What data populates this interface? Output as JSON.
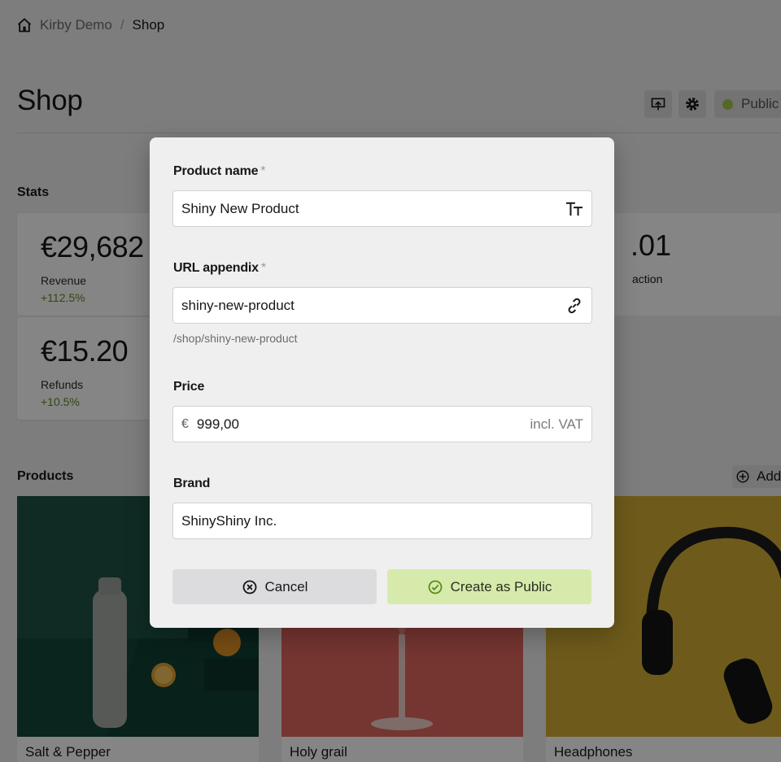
{
  "breadcrumb": {
    "site": "Kirby Demo",
    "separator": "/",
    "current": "Shop"
  },
  "page": {
    "title": "Shop",
    "status_label": "Public"
  },
  "stats": {
    "heading": "Stats",
    "items": [
      {
        "value": "€29,682",
        "label": "Revenue",
        "delta": "+112.5%"
      },
      {
        "value": "€15.20",
        "label": "Refunds",
        "delta": "+10.5%"
      }
    ],
    "partial": {
      "value": ".01",
      "label": "action"
    }
  },
  "products": {
    "heading": "Products",
    "add_label": "Add",
    "items": [
      {
        "name": "Salt & Pepper"
      },
      {
        "name": "Holy grail"
      },
      {
        "name": "Headphones"
      }
    ]
  },
  "dialog": {
    "product_name": {
      "label": "Product name",
      "required": "*",
      "value": "Shiny New Product",
      "icon": "text-icon"
    },
    "url_appendix": {
      "label": "URL appendix",
      "required": "*",
      "value": "shiny-new-product",
      "help": "/shop/shiny-new-product",
      "icon": "link-icon"
    },
    "price": {
      "label": "Price",
      "currency": "€",
      "value": "999,00",
      "after": "incl. VAT"
    },
    "brand": {
      "label": "Brand",
      "value": "ShinyShiny Inc."
    },
    "cancel_label": "Cancel",
    "create_label": "Create as Public"
  },
  "colors": {
    "accent_green": "#d6ebab",
    "positive": "#5f8c1e",
    "status_dot": "#a5c84a"
  }
}
